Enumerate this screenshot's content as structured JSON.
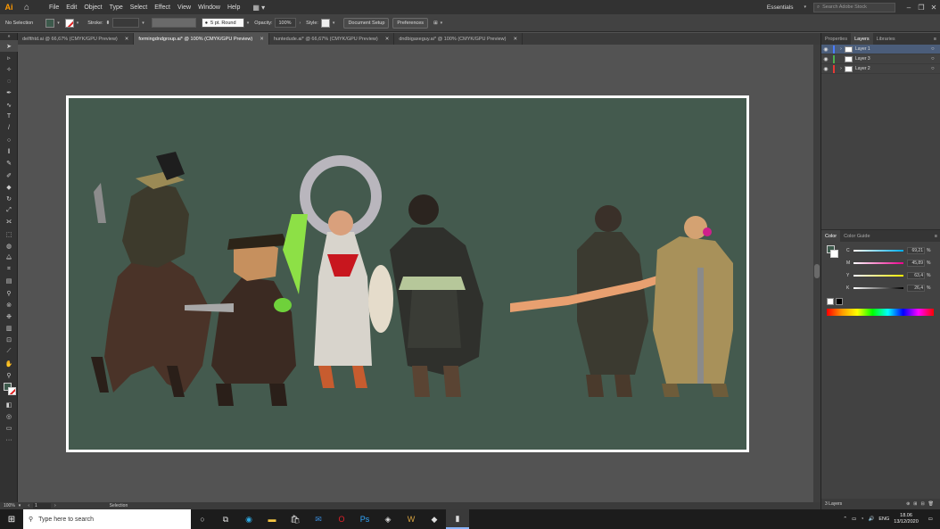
{
  "app": {
    "logo": "Ai",
    "menu": [
      "File",
      "Edit",
      "Object",
      "Type",
      "Select",
      "Effect",
      "View",
      "Window",
      "Help"
    ],
    "workspace": "Essentials",
    "search_placeholder": "Search Adobe Stock"
  },
  "control_bar": {
    "selection": "No Selection",
    "stroke_label": "Stroke:",
    "brush": "5 pt. Round",
    "opacity_label": "Opacity:",
    "opacity_value": "100%",
    "style_label": "Style:",
    "document_setup": "Document Setup",
    "preferences": "Preferences"
  },
  "tabs": [
    {
      "label": "delfthtd.ai @ 66,67% (CMYK/GPU Preview)",
      "active": false
    },
    {
      "label": "formingdndgroup.ai* @ 100% (CMYK/GPU Preview)",
      "active": true
    },
    {
      "label": "huntedude.ai* @ 66,67% (CMYK/GPU Preview)",
      "active": false
    },
    {
      "label": "dndbigaxeguy.ai* @ 100% (CMYK/GPU Preview)",
      "active": false
    }
  ],
  "tools": [
    "selection-tool",
    "direct-selection-tool",
    "magic-wand-tool",
    "lasso-tool",
    "pen-tool",
    "curvature-tool",
    "type-tool",
    "line-tool",
    "ellipse-tool",
    "paintbrush-tool",
    "pencil-tool",
    "shaper-tool",
    "eraser-tool",
    "rotate-tool",
    "scale-tool",
    "width-tool",
    "free-transform-tool",
    "shape-builder-tool",
    "perspective-grid-tool",
    "mesh-tool",
    "gradient-tool",
    "eyedropper-tool",
    "blend-tool",
    "symbol-sprayer-tool",
    "column-graph-tool",
    "artboard-tool",
    "slice-tool",
    "hand-tool",
    "zoom-tool"
  ],
  "canvas": {
    "background_color": "#445a4e"
  },
  "status": {
    "zoom": "100%",
    "artboard": "1",
    "tool": "Selection"
  },
  "panels": {
    "tabs": [
      "Properties",
      "Layers",
      "Libraries"
    ],
    "active_tab": "Layers",
    "layers": [
      {
        "name": "Layer 1",
        "color": "#4a7bff",
        "selected": true
      },
      {
        "name": "Layer 3",
        "color": "#4caf50",
        "selected": false
      },
      {
        "name": "Layer 2",
        "color": "#e53935",
        "selected": false
      }
    ],
    "layers_count": "3 Layers",
    "color_tabs": [
      "Color",
      "Color Guide"
    ],
    "cmyk": [
      {
        "channel": "C",
        "value": "69,21",
        "unit": "%"
      },
      {
        "channel": "M",
        "value": "45,89",
        "unit": "%"
      },
      {
        "channel": "Y",
        "value": "63,4",
        "unit": "%"
      },
      {
        "channel": "K",
        "value": "26,4",
        "unit": "%"
      }
    ]
  },
  "taskbar": {
    "search_placeholder": "Type here to search",
    "language": "ENG",
    "time": "18.06",
    "date": "13/12/2020"
  }
}
